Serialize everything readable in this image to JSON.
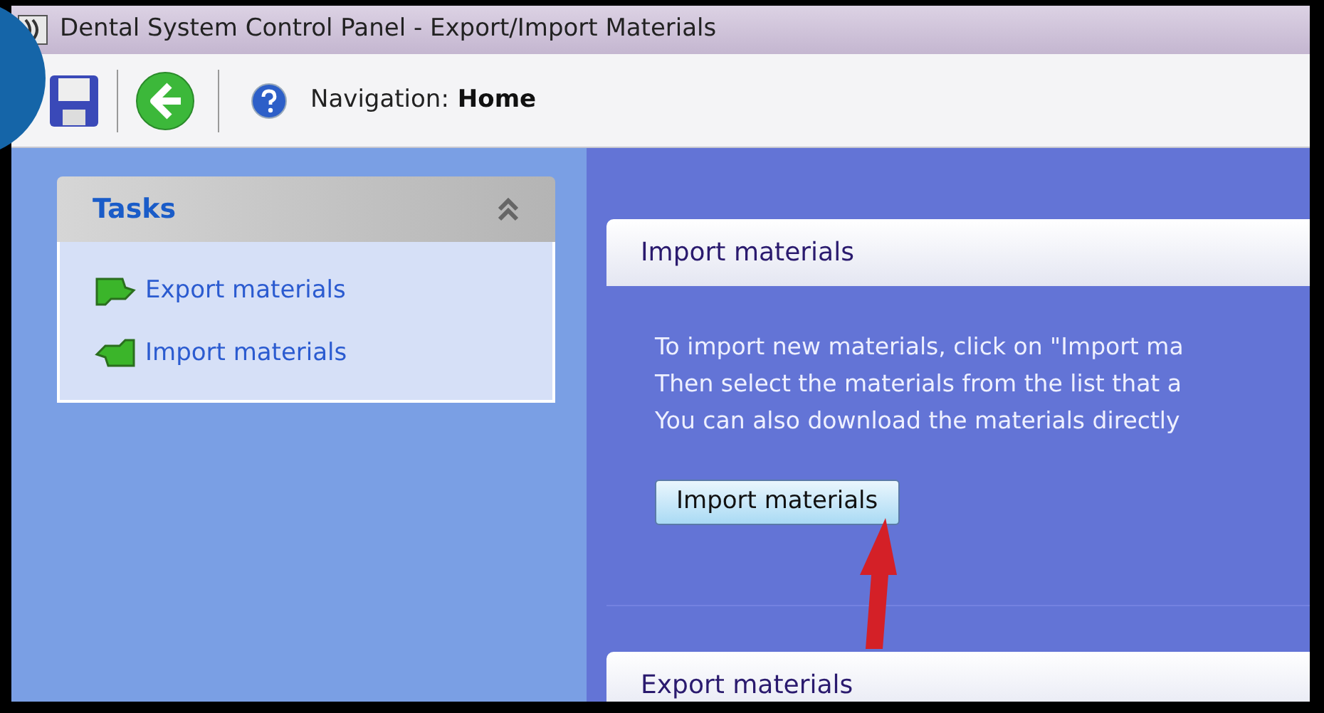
{
  "window": {
    "title": "Dental System Control Panel - Export/Import Materials"
  },
  "toolbar": {
    "navigation_label": "Navigation:",
    "navigation_value": "Home"
  },
  "tasks": {
    "title": "Tasks",
    "expanded": true,
    "items": [
      {
        "label": "Export materials",
        "kind": "export"
      },
      {
        "label": "Import materials",
        "kind": "import"
      }
    ]
  },
  "sections": [
    {
      "title": "Import materials",
      "lines": [
        "To import new materials, click on \"Import ma",
        "Then select the materials from the list that a",
        "You can also download the materials directly"
      ],
      "button": "Import materials"
    },
    {
      "title": "Export materials"
    }
  ]
}
